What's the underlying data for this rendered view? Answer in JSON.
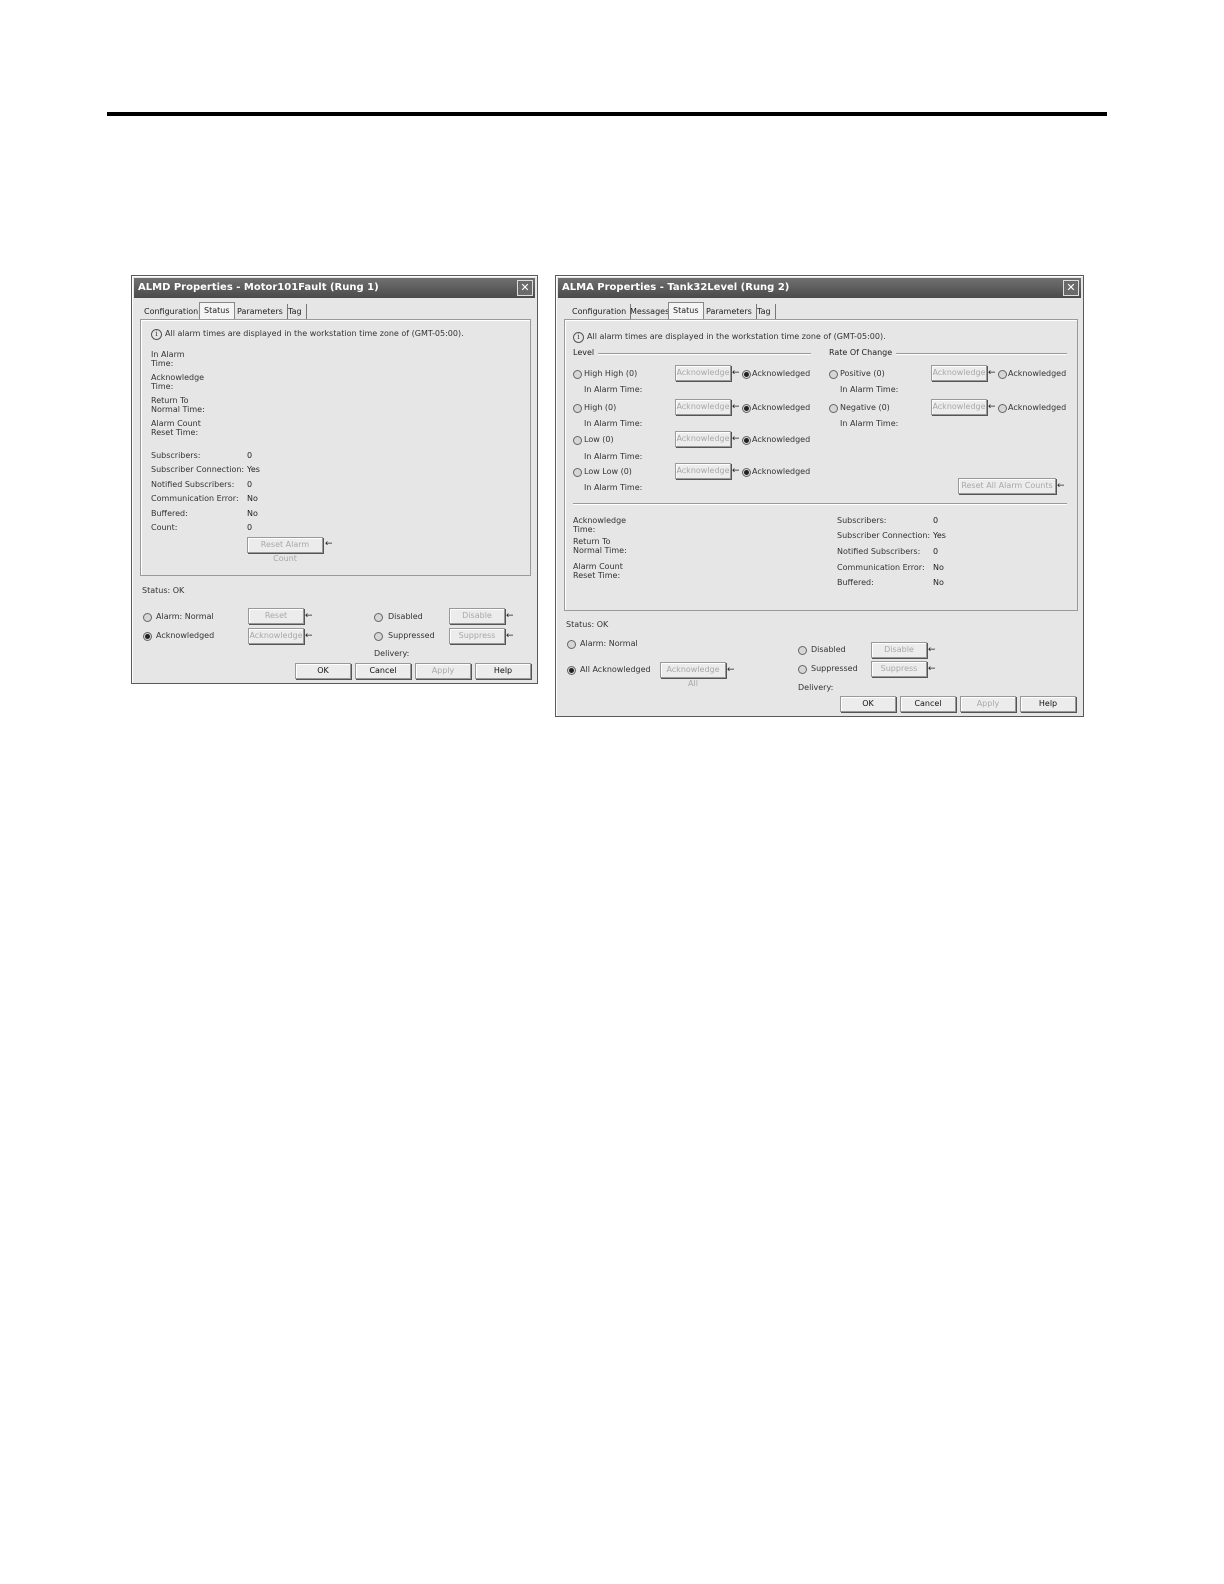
{
  "almd": {
    "title": "ALMD Properties - Motor101Fault (Rung 1)",
    "close": "✕",
    "tabs": [
      "Configuration",
      "Status",
      "Parameters",
      "Tag"
    ],
    "info_text": "All alarm times are displayed in the workstation time zone of (GMT-05:00).",
    "times": [
      {
        "line1": "In Alarm",
        "line2": "Time:"
      },
      {
        "line1": "Acknowledge",
        "line2": "Time:"
      },
      {
        "line1": "Return To",
        "line2": "Normal Time:"
      },
      {
        "line1": "Alarm Count",
        "line2": "Reset Time:"
      }
    ],
    "fields": [
      {
        "label": "Subscribers:",
        "value": "0"
      },
      {
        "label": "Subscriber Connection:",
        "value": "Yes"
      },
      {
        "label": "Notified Subscribers:",
        "value": "0"
      },
      {
        "label": "Communication Error:",
        "value": "No"
      },
      {
        "label": "Buffered:",
        "value": "No"
      },
      {
        "label": "Count:",
        "value": "0"
      }
    ],
    "reset_alarm_count": "Reset Alarm Count",
    "status": "Status:  OK",
    "alarm_normal": "Alarm:  Normal",
    "acknowledged": "Acknowledged",
    "reset": "Reset",
    "acknowledge": "Acknowledge",
    "disabled": "Disabled",
    "suppressed": "Suppressed",
    "disable": "Disable",
    "suppress": "Suppress",
    "delivery": "Delivery:",
    "ok": "OK",
    "cancel": "Cancel",
    "apply": "Apply",
    "help": "Help"
  },
  "alma": {
    "title": "ALMA Properties - Tank32Level (Rung 2)",
    "close": "✕",
    "tabs": [
      "Configuration",
      "Messages",
      "Status",
      "Parameters",
      "Tag"
    ],
    "info_text": "All alarm times are displayed in the workstation time zone of (GMT-05:00).",
    "level_group": "Level",
    "roc_group": "Rate Of Change",
    "level_items": [
      {
        "label": "High High (0)",
        "time": "In Alarm Time:",
        "ack_btn": "Acknowledge",
        "ack": "Acknowledged"
      },
      {
        "label": "High (0)",
        "time": "In Alarm Time:",
        "ack_btn": "Acknowledge",
        "ack": "Acknowledged"
      },
      {
        "label": "Low (0)",
        "time": "In Alarm Time:",
        "ack_btn": "Acknowledge",
        "ack": "Acknowledged"
      },
      {
        "label": "Low Low (0)",
        "time": "In Alarm Time:",
        "ack_btn": "Acknowledge",
        "ack": "Acknowledged"
      }
    ],
    "roc_items": [
      {
        "label": "Positive (0)",
        "time": "In Alarm Time:",
        "ack_btn": "Acknowledge",
        "ack": "Acknowledged"
      },
      {
        "label": "Negative (0)",
        "time": "In Alarm Time:",
        "ack_btn": "Acknowledge",
        "ack": "Acknowledged"
      }
    ],
    "reset_all": "Reset All Alarm Counts",
    "times": [
      {
        "line1": "Acknowledge",
        "line2": "Time:"
      },
      {
        "line1": "Return To",
        "line2": "Normal Time:"
      },
      {
        "line1": "Alarm Count",
        "line2": "Reset Time:"
      }
    ],
    "fields": [
      {
        "label": "Subscribers:",
        "value": "0"
      },
      {
        "label": "Subscriber Connection:",
        "value": "Yes"
      },
      {
        "label": "Notified Subscribers:",
        "value": "0"
      },
      {
        "label": "Communication Error:",
        "value": "No"
      },
      {
        "label": "Buffered:",
        "value": "No"
      }
    ],
    "status": "Status:  OK",
    "alarm_normal": "Alarm:  Normal",
    "all_acknowledged": "All Acknowledged",
    "acknowledge_all": "Acknowledge All",
    "disabled": "Disabled",
    "suppressed": "Suppressed",
    "disable": "Disable",
    "suppress": "Suppress",
    "delivery": "Delivery:",
    "ok": "OK",
    "cancel": "Cancel",
    "apply": "Apply",
    "help": "Help"
  }
}
